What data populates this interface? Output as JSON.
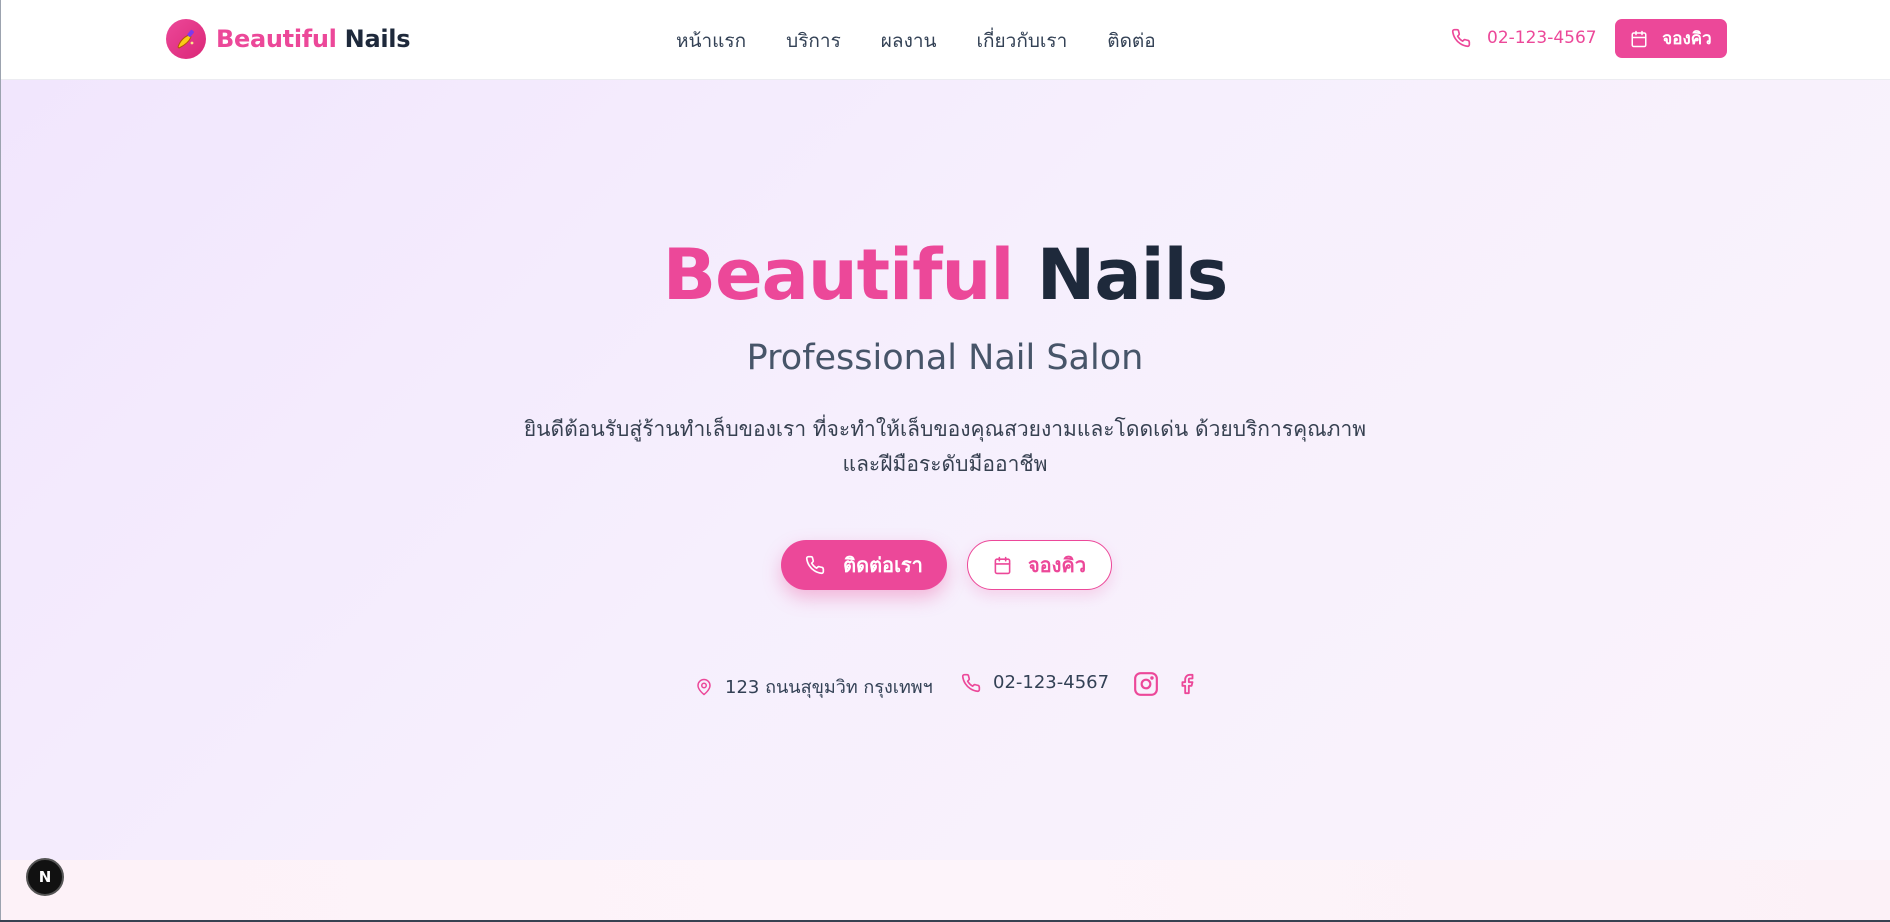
{
  "brand": {
    "name_part1": "Beautiful",
    "name_part2": "Nails",
    "logo_icon": "nail-polish-icon",
    "accent_color": "#ec4899",
    "dark_color": "#1e293b"
  },
  "nav": {
    "items": [
      {
        "label": "หน้าแรก"
      },
      {
        "label": "บริการ"
      },
      {
        "label": "ผลงาน"
      },
      {
        "label": "เกี่ยวกับเรา"
      },
      {
        "label": "ติดต่อ"
      }
    ]
  },
  "header": {
    "phone": "02-123-4567",
    "book_label": "จองคิว"
  },
  "hero": {
    "title_part1": "Beautiful",
    "title_part2": "Nails",
    "subtitle": "Professional Nail Salon",
    "description_line1": "ยินดีต้อนรับสู่ร้านทำเล็บของเรา ที่จะทำให้เล็บของคุณสวยงามและโดดเด่น ด้วยบริการคุณภาพ",
    "description_line2": "และฝีมือระดับมืออาชีพ",
    "contact_button": "ติดต่อเรา",
    "book_button": "จองคิว",
    "background_colors": [
      "#f1e6fd",
      "#fbf4fb"
    ]
  },
  "info": {
    "address": "123 ถนนสุขุมวิท กรุงเทพฯ",
    "phone": "02-123-4567",
    "icons": [
      "map-pin-icon",
      "phone-icon",
      "instagram-icon",
      "facebook-icon"
    ]
  },
  "dev_badge": {
    "label": "N"
  }
}
